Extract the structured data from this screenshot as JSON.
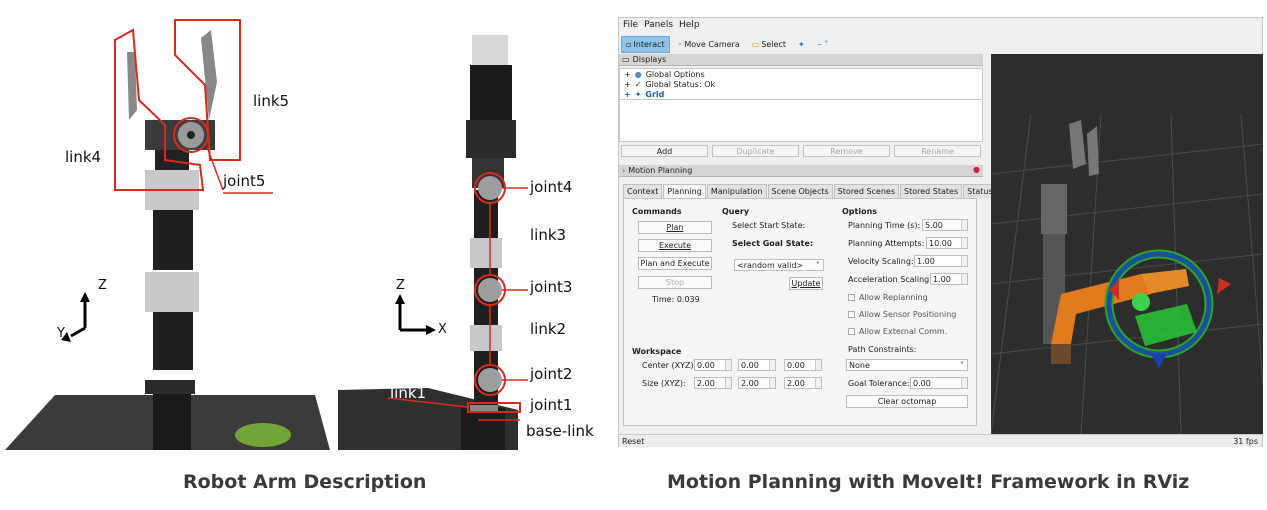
{
  "left_figure": {
    "caption": "Robot Arm Description",
    "front_view": {
      "labels": {
        "link5": "link5",
        "link4": "link4",
        "joint5": "joint5"
      },
      "axes": {
        "z": "Z",
        "y": "Y"
      }
    },
    "side_view": {
      "labels": {
        "joint4": "joint4",
        "link3": "link3",
        "joint3": "joint3",
        "link2": "link2",
        "joint2": "joint2",
        "joint1": "joint1",
        "link1": "link1",
        "base_link": "base-link"
      },
      "axes": {
        "z": "Z",
        "x": "X"
      }
    }
  },
  "right_figure": {
    "caption": "Motion Planning with MoveIt! Framework in RViz",
    "menu": [
      "File",
      "Panels",
      "Help"
    ],
    "toolbar": {
      "interact": "Interact",
      "move_camera": "Move Camera",
      "select": "Select"
    },
    "displays": {
      "title": "Displays",
      "items": [
        "Global Options",
        "Global Status: Ok",
        "Grid"
      ],
      "buttons": {
        "add": "Add",
        "duplicate": "Duplicate",
        "remove": "Remove",
        "rename": "Rename"
      }
    },
    "motion_planning": {
      "title": "Motion Planning",
      "tabs": [
        "Context",
        "Planning",
        "Manipulation",
        "Scene Objects",
        "Stored Scenes",
        "Stored States",
        "Status"
      ],
      "commands": {
        "title": "Commands",
        "plan": "Plan",
        "execute": "Execute",
        "plan_and_execute": "Plan and Execute",
        "stop": "Stop",
        "time": "Time: 0.039"
      },
      "query": {
        "title": "Query",
        "start_state": "Select Start State:",
        "goal_state": "Select Goal State:",
        "goal_value": "<random valid>",
        "update": "Update"
      },
      "options": {
        "title": "Options",
        "planning_time_label": "Planning Time (s):",
        "planning_time": "5.00",
        "planning_attempts_label": "Planning Attempts:",
        "planning_attempts": "10.00",
        "velocity_label": "Velocity Scaling:",
        "velocity": "1.00",
        "acceleration_label": "Acceleration Scaling:",
        "acceleration": "1.00",
        "allow_replanning": "Allow Replanning",
        "allow_sensor": "Allow Sensor Positioning",
        "allow_external": "Allow External Comm.",
        "path_constraints": "Path Constraints:",
        "path_constraints_value": "None",
        "goal_tolerance_label": "Goal Tolerance:",
        "goal_tolerance": "0.00",
        "clear_octomap": "Clear octomap"
      },
      "workspace": {
        "title": "Workspace",
        "center_label": "Center (XYZ):",
        "center": [
          "0.00",
          "0.00",
          "0.00"
        ],
        "size_label": "Size (XYZ):",
        "size": [
          "2.00",
          "2.00",
          "2.00"
        ]
      }
    },
    "status": {
      "reset": "Reset",
      "fps": "31 fps"
    }
  }
}
